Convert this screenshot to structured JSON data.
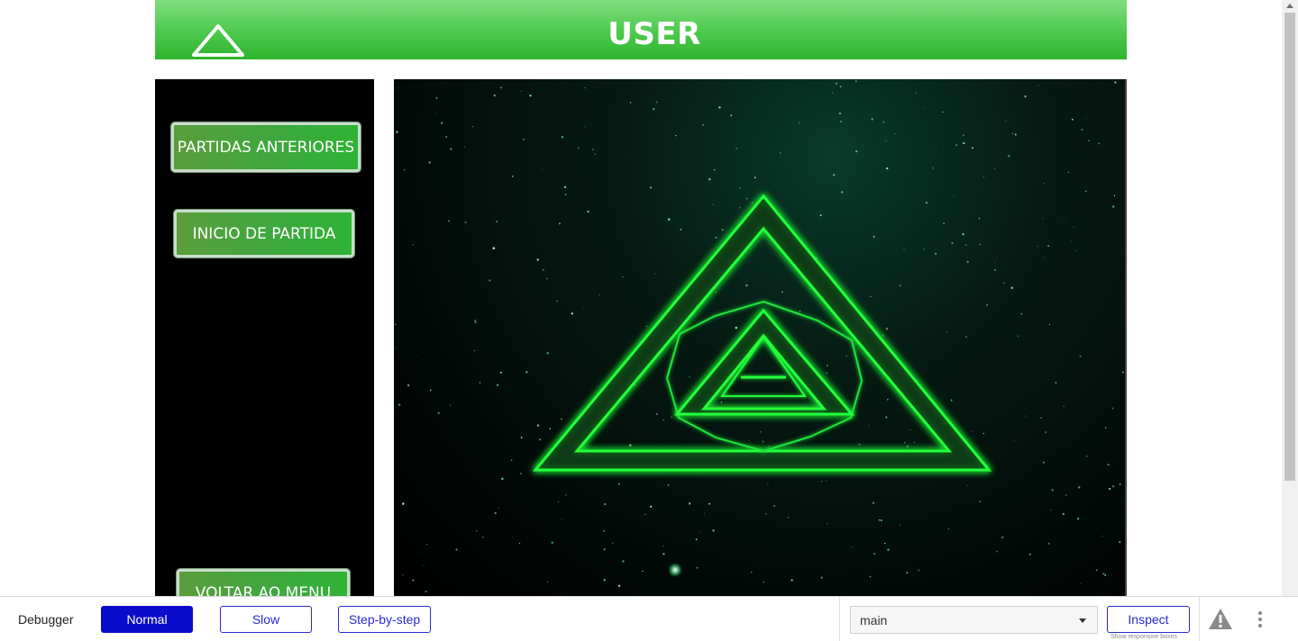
{
  "header": {
    "title": "USER",
    "logo_icon": "triangle-outline-icon",
    "bg_color": "#4cc94c"
  },
  "sidebar": {
    "buttons": [
      {
        "label": "PARTIDAS ANTERIORES"
      },
      {
        "label": "INICIO DE PARTIDA"
      },
      {
        "label": "VOLTAR AO MENU"
      }
    ]
  },
  "game": {
    "graphic": "nested-neon-triangles",
    "accent_color": "#22ff3a"
  },
  "debugger": {
    "label": "Debugger",
    "modes": [
      "Normal",
      "Slow",
      "Step-by-step"
    ],
    "active_mode": "Normal",
    "select_value": "main",
    "inspect_label": "Inspect",
    "inspect_hint": "Show responsive boxes",
    "warning_icon": "warning-triangle-icon",
    "more_icon": "more-vertical-icon"
  }
}
